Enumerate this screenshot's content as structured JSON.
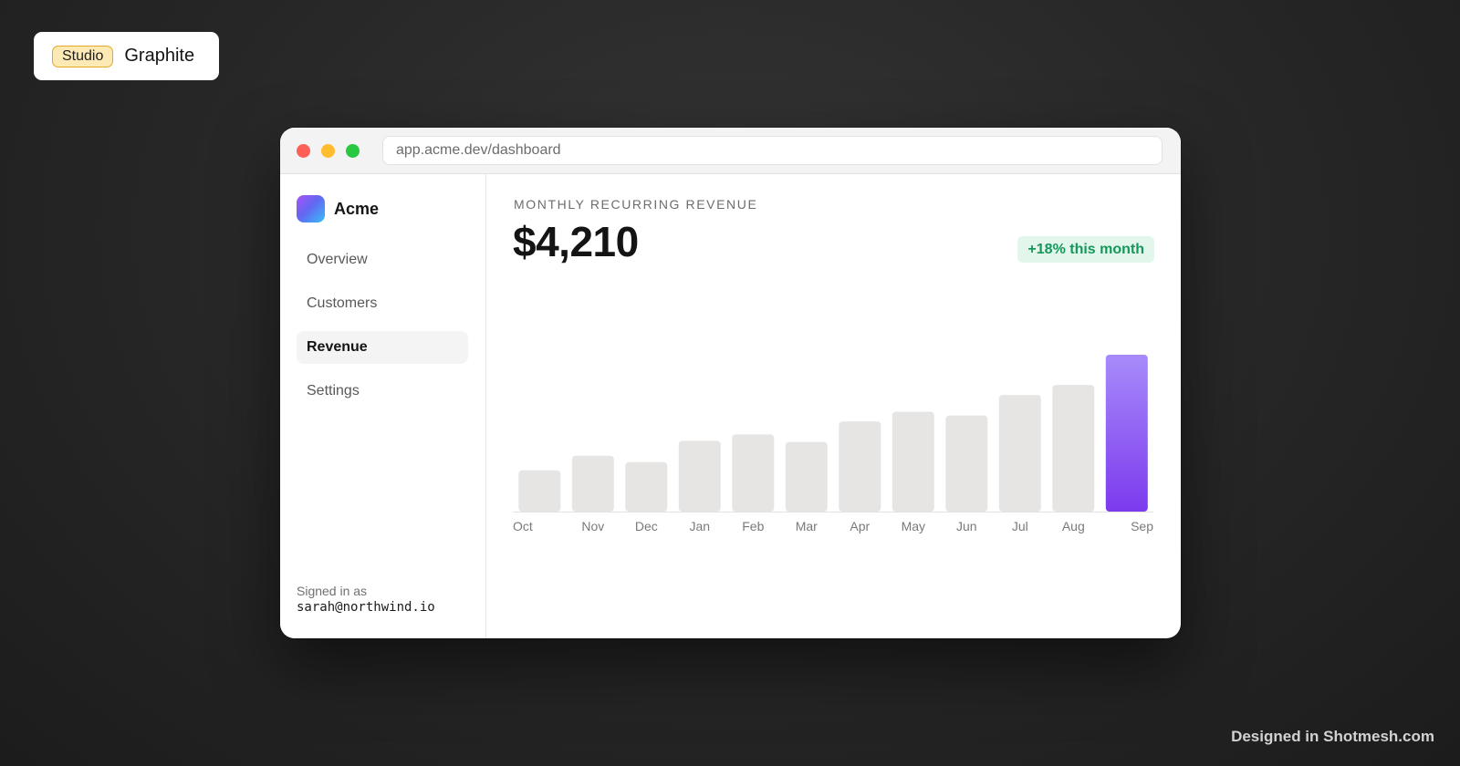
{
  "branding": {
    "studio_tag": "Studio",
    "name": "Graphite"
  },
  "browser": {
    "url": "app.acme.dev/dashboard"
  },
  "sidebar": {
    "app_name": "Acme",
    "nav": [
      {
        "label": "Overview",
        "active": false
      },
      {
        "label": "Customers",
        "active": false
      },
      {
        "label": "Revenue",
        "active": true
      },
      {
        "label": "Settings",
        "active": false
      }
    ],
    "signed_in_label": "Signed in as",
    "signed_in_email": "sarah@northwind.io"
  },
  "metric": {
    "label": "MONTHLY RECURRING REVENUE",
    "value": "$4,210",
    "change": "+18% this month"
  },
  "chart_data": {
    "type": "bar",
    "categories": [
      "Oct",
      "Nov",
      "Dec",
      "Jan",
      "Feb",
      "Mar",
      "Apr",
      "May",
      "Jun",
      "Jul",
      "Aug",
      "Sep"
    ],
    "values": [
      1110,
      1500,
      1330,
      1900,
      2070,
      1870,
      2420,
      2680,
      2580,
      3130,
      3400,
      4210
    ],
    "highlight_index": 11,
    "bar_color": "#e7e5e4",
    "highlight_color_top": "#a78bfa",
    "highlight_color_bottom": "#7c3aed",
    "axis_color": "#e2e2e2",
    "label_color": "#7a7a7a"
  },
  "footer": {
    "credit": "Designed in Shotmesh.com"
  }
}
